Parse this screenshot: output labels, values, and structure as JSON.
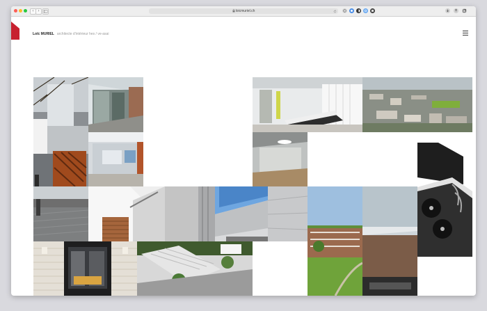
{
  "browser": {
    "url": "loicmuriel.ch",
    "nav_back": "‹",
    "nav_forward": "›"
  },
  "site": {
    "name": "Loïc MURIEL",
    "tagline": "architecte d'intérieur hes / ve-asai"
  },
  "colors": {
    "brand_red": "#c7202f"
  },
  "icons": {
    "menu": "hamburger-menu-icon"
  }
}
